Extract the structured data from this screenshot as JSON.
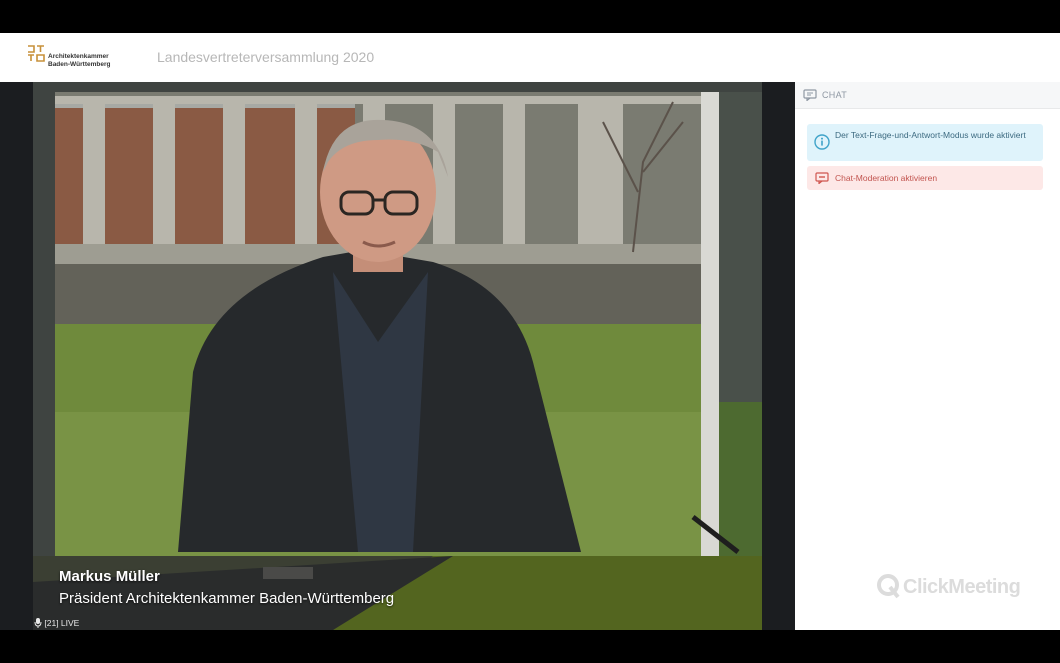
{
  "header": {
    "logo_line1": "Architektenkammer",
    "logo_line2": "Baden-Württemberg",
    "event_title": "Landesvertreterversammlung 2020"
  },
  "video": {
    "speaker_name": "Markus Müller",
    "speaker_role": "Präsident Architektenkammer Baden-Württemberg",
    "attendees_indicator": "[21] LIVE"
  },
  "chat": {
    "title": "CHAT",
    "messages": [
      {
        "type": "info",
        "text": "Der Text-Frage-und-Antwort-Modus wurde aktiviert",
        "icon": "info-icon"
      },
      {
        "type": "moderation",
        "text": "Chat-Moderation aktivieren",
        "icon": "moderation-icon"
      }
    ]
  },
  "branding": {
    "watermark": "ClickMeeting"
  },
  "colors": {
    "info_bg": "#dff3fb",
    "moderation_bg": "#fde8e7",
    "moderation_text": "#c2544f"
  }
}
